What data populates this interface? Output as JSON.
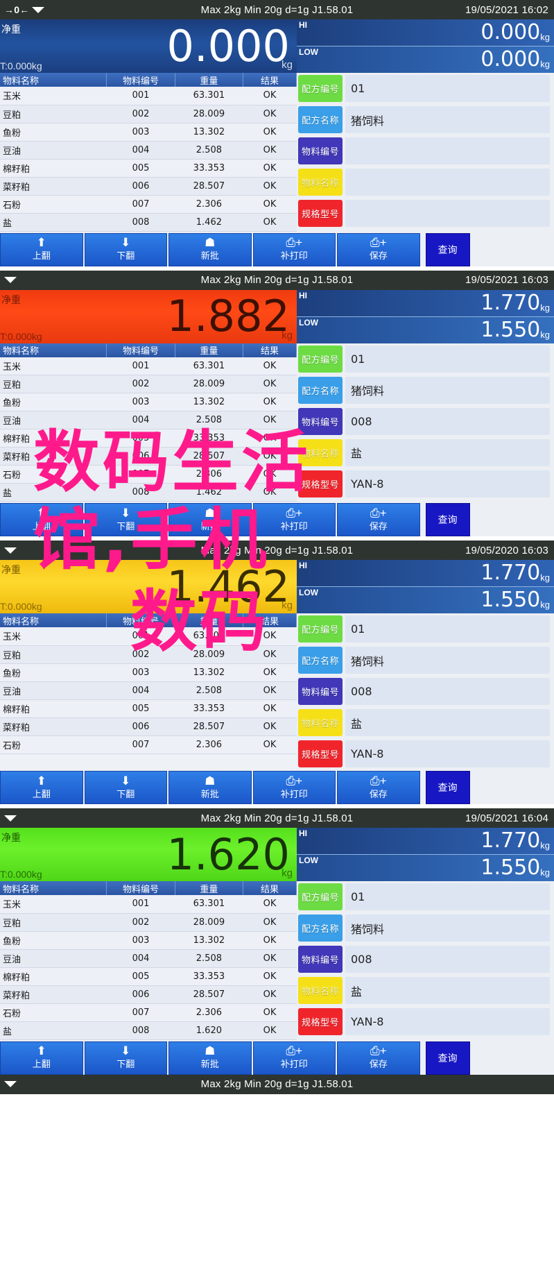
{
  "device": {
    "spec_line": "Max 2kg  Min 20g  d=1g    J1.58.01",
    "zero_icon": "zero-indicator-icon",
    "arrow_icon": "left-arrow-icon",
    "wedge_icon": "stable-wedge-icon",
    "net_label": "净重",
    "tare_label": "T:0.000kg",
    "unit": "kg",
    "hi_tag": "HI",
    "low_tag": "LOW"
  },
  "table": {
    "headers": [
      "物料名称",
      "物料编号",
      "重量",
      "结果"
    ],
    "rows_full": [
      [
        "玉米",
        "001",
        "63.301",
        "OK"
      ],
      [
        "豆粕",
        "002",
        "28.009",
        "OK"
      ],
      [
        "鱼粉",
        "003",
        "13.302",
        "OK"
      ],
      [
        "豆油",
        "004",
        "2.508",
        "OK"
      ],
      [
        "棉籽粕",
        "005",
        "33.353",
        "OK"
      ],
      [
        "菜籽粕",
        "006",
        "28.507",
        "OK"
      ],
      [
        "石粉",
        "007",
        "2.306",
        "OK"
      ],
      [
        "盐",
        "008",
        "1.462",
        "OK"
      ]
    ],
    "rows_seven": [
      [
        "玉米",
        "001",
        "63.301",
        "OK"
      ],
      [
        "豆粕",
        "002",
        "28.009",
        "OK"
      ],
      [
        "鱼粉",
        "003",
        "13.302",
        "OK"
      ],
      [
        "豆油",
        "004",
        "2.508",
        "OK"
      ],
      [
        "棉籽粕",
        "005",
        "33.353",
        "OK"
      ],
      [
        "菜籽粕",
        "006",
        "28.507",
        "OK"
      ],
      [
        "石粉",
        "007",
        "2.306",
        "OK"
      ]
    ],
    "rows_last_1620": [
      [
        "玉米",
        "001",
        "63.301",
        "OK"
      ],
      [
        "豆粕",
        "002",
        "28.009",
        "OK"
      ],
      [
        "鱼粉",
        "003",
        "13.302",
        "OK"
      ],
      [
        "豆油",
        "004",
        "2.508",
        "OK"
      ],
      [
        "棉籽粕",
        "005",
        "33.353",
        "OK"
      ],
      [
        "菜籽粕",
        "006",
        "28.507",
        "OK"
      ],
      [
        "石粉",
        "007",
        "2.306",
        "OK"
      ],
      [
        "盐",
        "008",
        "1.620",
        "OK"
      ]
    ]
  },
  "form_labels": {
    "recipe_code": "配方编号",
    "recipe_name": "配方名称",
    "material_code": "物料编号",
    "material_name": "物料名称",
    "model_spec": "规格型号"
  },
  "form_colors": {
    "recipe_code": "#6ddc44",
    "recipe_name": "#3a9fe8",
    "material_code": "#4137b8",
    "material_name": "#f5e018",
    "model_spec": "#f0252c"
  },
  "toolbar": {
    "page_up": "上翻",
    "page_down": "下翻",
    "new_batch": "新批",
    "reprint": "补打印",
    "save": "保存",
    "query": "查询",
    "icons": {
      "page_up": "arrow-up-icon",
      "page_down": "arrow-down-icon",
      "new_batch": "stack-icon",
      "reprint": "printer-plus-icon",
      "save": "printer-plus-icon"
    }
  },
  "panels": [
    {
      "id": "panel-1",
      "datetime": "19/05/2021  16:02",
      "weight": "0.000",
      "weight_color": "#1f4a8f",
      "weight_theme": "blue",
      "hi": "0.000",
      "low": "0.000",
      "form_values": {
        "recipe_code": "01",
        "recipe_name": "猪饲料",
        "material_code": "",
        "material_name": "",
        "model_spec": ""
      }
    },
    {
      "id": "panel-2",
      "datetime": "19/05/2021  16:03",
      "weight": "1.882",
      "weight_color": "#ff4a16",
      "weight_theme": "red",
      "hi": "1.770",
      "low": "1.550",
      "form_values": {
        "recipe_code": "01",
        "recipe_name": "猪饲料",
        "material_code": "008",
        "material_name": "盐",
        "model_spec": "YAN-8"
      }
    },
    {
      "id": "panel-3",
      "datetime": "19/05/2020  16:03",
      "weight": "1.462",
      "weight_color": "#ffd92e",
      "weight_theme": "yellow",
      "hi": "1.770",
      "low": "1.550",
      "form_values": {
        "recipe_code": "01",
        "recipe_name": "猪饲料",
        "material_code": "008",
        "material_name": "盐",
        "model_spec": "YAN-8"
      }
    },
    {
      "id": "panel-4",
      "datetime": "19/05/2021  16:04",
      "weight": "1.620",
      "weight_color": "#6cf02b",
      "weight_theme": "green",
      "hi": "1.770",
      "low": "1.550",
      "form_values": {
        "recipe_code": "01",
        "recipe_name": "猪饲料",
        "material_code": "008",
        "material_name": "盐",
        "model_spec": "YAN-8"
      }
    }
  ],
  "footer": {
    "spec_line": "Max 2kg  Min 20g  d=1g    J1.58.01"
  },
  "watermark": {
    "line1": "数码生活",
    "line2": "馆,手机",
    "line3": "数码",
    "color": "#ff1a8c"
  }
}
